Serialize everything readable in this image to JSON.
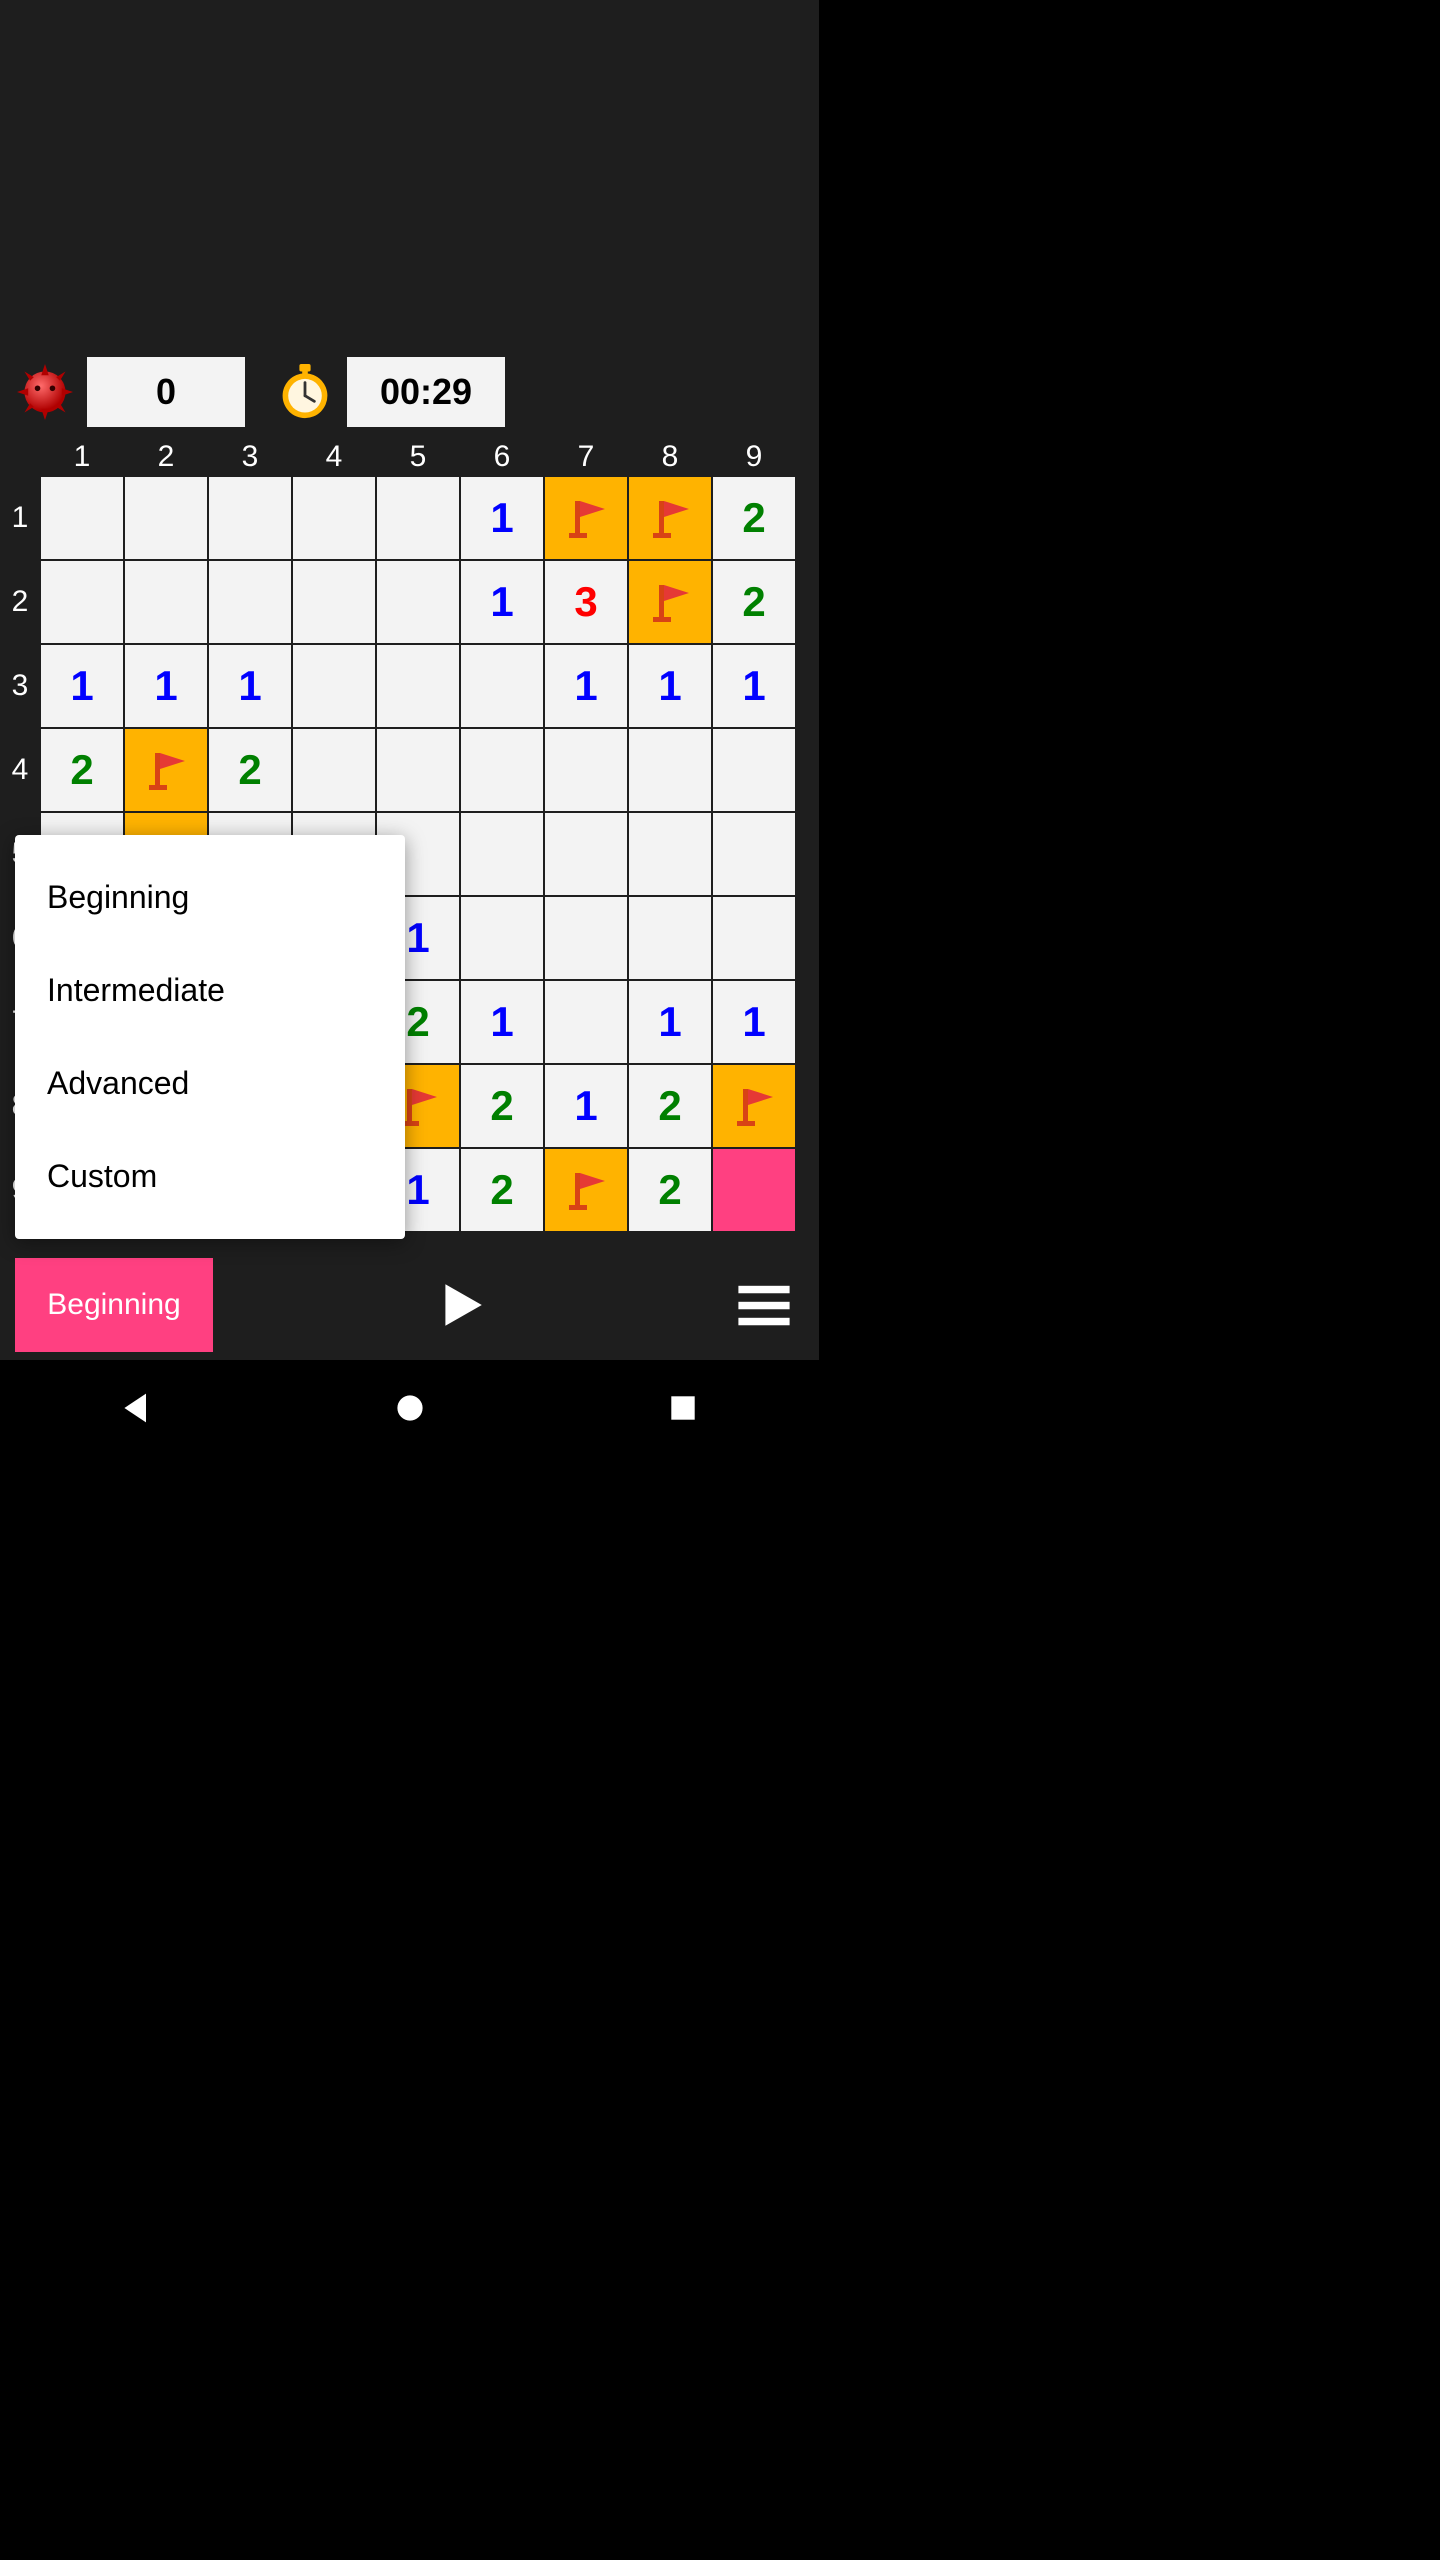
{
  "status": {
    "mines_remaining": "0",
    "elapsed_time": "00:29"
  },
  "columns": [
    "1",
    "2",
    "3",
    "4",
    "5",
    "6",
    "7",
    "8",
    "9"
  ],
  "rows": [
    "1",
    "2",
    "3",
    "4",
    "5",
    "6",
    "7",
    "8",
    "9"
  ],
  "board": [
    [
      "",
      "",
      "",
      "",
      "",
      "1",
      "F",
      "F",
      "2"
    ],
    [
      "",
      "",
      "",
      "",
      "",
      "1",
      "3",
      "F",
      "2"
    ],
    [
      "1",
      "1",
      "1",
      "",
      "",
      "",
      "1",
      "1",
      "1"
    ],
    [
      "2",
      "F",
      "2",
      "",
      "",
      "",
      "",
      "",
      ""
    ],
    [
      "",
      "F",
      "",
      "",
      "",
      "",
      "",
      "",
      ""
    ],
    [
      "",
      "",
      "",
      "",
      "1",
      "",
      "",
      "",
      ""
    ],
    [
      "",
      "",
      "",
      "",
      "2",
      "1",
      "",
      "1",
      "1"
    ],
    [
      "",
      "",
      "",
      "",
      "F",
      "2",
      "1",
      "2",
      "F"
    ],
    [
      "",
      "",
      "",
      "",
      "1",
      "2",
      "F",
      "2",
      "P"
    ]
  ],
  "dropdown": {
    "items": [
      "Beginning",
      "Intermediate",
      "Advanced",
      "Custom"
    ]
  },
  "footer": {
    "level_label": "Beginning"
  },
  "icons": {
    "mine": "mine-icon",
    "stopwatch": "stopwatch-icon",
    "flag": "flag-icon",
    "play": "play-icon",
    "hamburger": "hamburger-icon",
    "nav_back": "back-triangle-icon",
    "nav_home": "circle-icon",
    "nav_recent": "square-icon"
  }
}
